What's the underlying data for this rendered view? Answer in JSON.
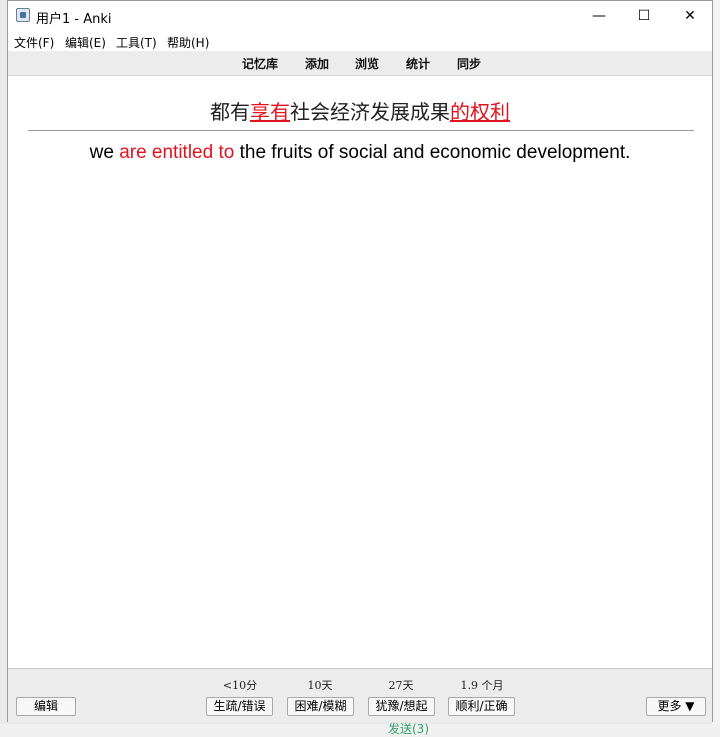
{
  "window": {
    "title": "用户1 - Anki",
    "minimize_glyph": "—",
    "maximize_glyph": "☐",
    "close_glyph": "✕"
  },
  "menu": {
    "items": [
      {
        "label": "文件(F)"
      },
      {
        "label": "编辑(E)"
      },
      {
        "label": "工具(T)"
      },
      {
        "label": "帮助(H)"
      }
    ]
  },
  "toolbar": {
    "items": [
      {
        "label": "记忆库"
      },
      {
        "label": "添加"
      },
      {
        "label": "浏览"
      },
      {
        "label": "统计"
      },
      {
        "label": "同步"
      }
    ]
  },
  "card": {
    "question": {
      "part1": "都有",
      "hl1": "享有",
      "part2": "社会经济发展成果",
      "hl2": "的权利"
    },
    "answer": {
      "part1": "we ",
      "highlight": "are entitled to",
      "part2": " the fruits of social and economic development."
    }
  },
  "review": {
    "edit_label": "编辑",
    "more_label": "更多 ▼",
    "answers": [
      {
        "interval": "<10分",
        "label": "生疏/错误"
      },
      {
        "interval": "10天",
        "label": "困难/模糊"
      },
      {
        "interval": "27天",
        "label": "犹豫/想起"
      },
      {
        "interval": "1.9 个月",
        "label": "顺利/正确"
      }
    ]
  },
  "background": {
    "snippet": "发送(3)"
  },
  "colors": {
    "highlight": "#e0141e",
    "toolbar_bg": "#ececec",
    "background_link": "#38a169"
  }
}
